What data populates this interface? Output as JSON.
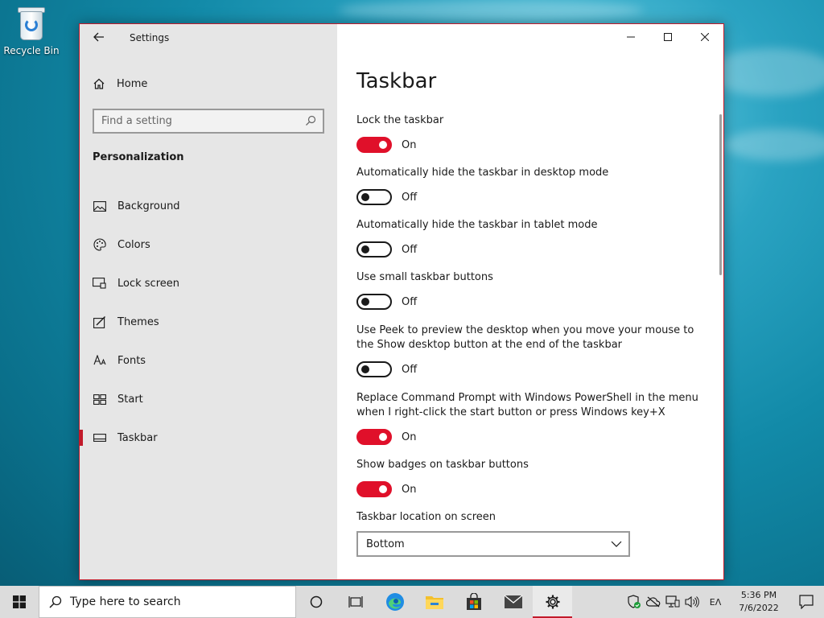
{
  "desktop": {
    "recycle_bin_label": "Recycle Bin"
  },
  "window": {
    "title": "Settings",
    "accent_color": "#e0102a"
  },
  "nav": {
    "home_label": "Home",
    "search_placeholder": "Find a setting",
    "section_title": "Personalization",
    "items": [
      {
        "label": "Background",
        "icon": "image-icon"
      },
      {
        "label": "Colors",
        "icon": "palette-icon"
      },
      {
        "label": "Lock screen",
        "icon": "lock-screen-icon"
      },
      {
        "label": "Themes",
        "icon": "themes-icon"
      },
      {
        "label": "Fonts",
        "icon": "fonts-icon"
      },
      {
        "label": "Start",
        "icon": "start-icon"
      },
      {
        "label": "Taskbar",
        "icon": "taskbar-icon",
        "active": true
      }
    ]
  },
  "main": {
    "title": "Taskbar",
    "settings": [
      {
        "label": "Lock the taskbar",
        "state": "On"
      },
      {
        "label": "Automatically hide the taskbar in desktop mode",
        "state": "Off"
      },
      {
        "label": "Automatically hide the taskbar in tablet mode",
        "state": "Off"
      },
      {
        "label": "Use small taskbar buttons",
        "state": "Off"
      },
      {
        "label": "Use Peek to preview the desktop when you move your mouse to the Show desktop button at the end of the taskbar",
        "state": "Off"
      },
      {
        "label": "Replace Command Prompt with Windows PowerShell in the menu when I right-click the start button or press Windows key+X",
        "state": "On"
      },
      {
        "label": "Show badges on taskbar buttons",
        "state": "On"
      }
    ],
    "location_label": "Taskbar location on screen",
    "location_value": "Bottom"
  },
  "taskbar": {
    "search_placeholder": "Type here to search",
    "language": "ΕΛ",
    "time": "5:36 PM",
    "date": "7/6/2022"
  }
}
